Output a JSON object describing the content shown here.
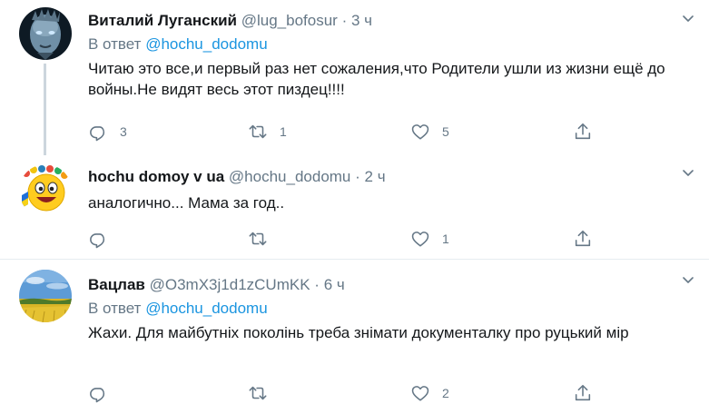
{
  "tweets": [
    {
      "name": "Виталий Луганский",
      "handle": "@lug_bofosur",
      "dot": "·",
      "time": "3 ч",
      "reply_prefix": "В ответ",
      "reply_mention": "@hochu_dodomu",
      "text": "Читаю это все,и первый раз нет сожаления,что Родители ушли из жизни ещё до войны.Не видят весь этот пиздец!!!!",
      "replies": "3",
      "retweets": "1",
      "likes": "5",
      "avatar_icon": "white-walker-avatar"
    },
    {
      "name": "hochu domoy v ua",
      "handle": "@hochu_dodomu",
      "dot": "·",
      "time": "2 ч",
      "text": "аналогично... Мама за год..",
      "replies": "",
      "retweets": "",
      "likes": "1",
      "avatar_icon": "emoji-avatar"
    },
    {
      "name": "Вацлав",
      "handle": "@O3mX3j1d1zCUmKK",
      "dot": "·",
      "time": "6 ч",
      "reply_prefix": "В ответ",
      "reply_mention": "@hochu_dodomu",
      "text": "Жахи. Для майбутніх поколінь треба знімати документалку про руцький мір",
      "replies": "",
      "retweets": "",
      "likes": "2",
      "avatar_icon": "wheat-field-avatar"
    }
  ],
  "colors": {
    "secondary": "#657786",
    "link": "#1b95e0",
    "text": "#14171a",
    "divider": "#e6ecf0"
  }
}
